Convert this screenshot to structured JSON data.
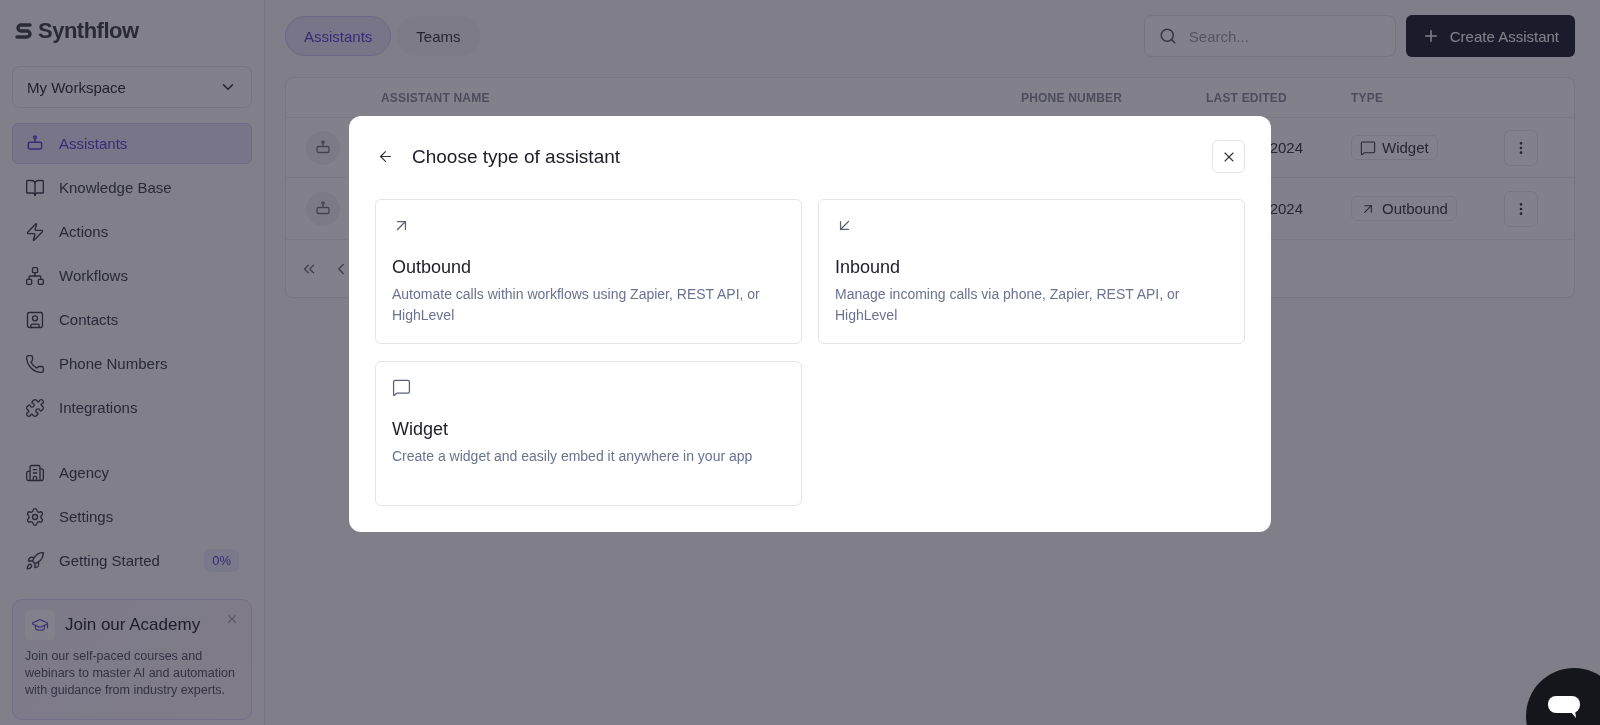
{
  "brand": "Synthflow",
  "workspace": "My Workspace",
  "nav": [
    {
      "label": "Assistants",
      "selected": true
    },
    {
      "label": "Knowledge Base",
      "selected": false
    },
    {
      "label": "Actions",
      "selected": false
    },
    {
      "label": "Workflows",
      "selected": false
    },
    {
      "label": "Contacts",
      "selected": false
    },
    {
      "label": "Phone Numbers",
      "selected": false
    },
    {
      "label": "Integrations",
      "selected": false
    }
  ],
  "nav_secondary": [
    {
      "label": "Agency",
      "selected": false
    },
    {
      "label": "Settings",
      "selected": false
    },
    {
      "label": "Getting Started",
      "selected": false,
      "badge": "0%"
    }
  ],
  "academy": {
    "title": "Join our Academy",
    "text": "Join our self-paced courses and webinars to master AI and automation with guidance from industry experts."
  },
  "tabs": [
    {
      "label": "Assistants",
      "selected": true
    },
    {
      "label": "Teams",
      "selected": false
    }
  ],
  "search": {
    "placeholder": "Search..."
  },
  "create_button": "Create Assistant",
  "table": {
    "columns": [
      "ASSISTANT NAME",
      "PHONE NUMBER",
      "LAST EDITED",
      "TYPE"
    ],
    "rows": [
      {
        "last_edited": "2024",
        "type": "Widget",
        "kind": "widget"
      },
      {
        "last_edited": "2024",
        "type": "Outbound",
        "kind": "outbound"
      }
    ]
  },
  "modal": {
    "title": "Choose type of assistant",
    "options": [
      {
        "kind": "outbound",
        "title": "Outbound",
        "description": "Automate calls within workflows using Zapier, REST API, or HighLevel"
      },
      {
        "kind": "inbound",
        "title": "Inbound",
        "description": "Manage incoming calls via phone, Zapier, REST API, or HighLevel"
      },
      {
        "kind": "widget",
        "title": "Widget",
        "description": "Create a widget and easily embed it anywhere in your app"
      }
    ]
  }
}
